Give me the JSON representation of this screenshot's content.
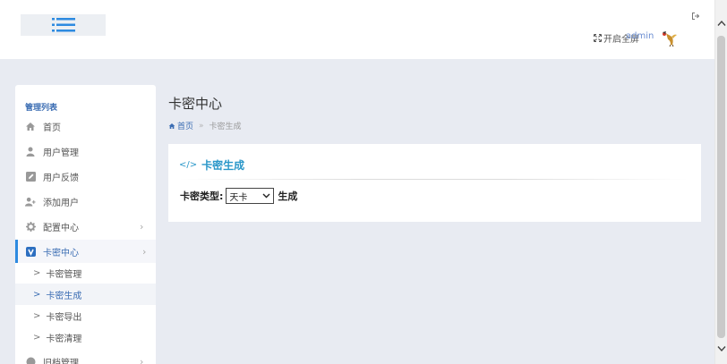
{
  "header": {
    "menu_toggle_icon": "hamburger-icon",
    "fullscreen_label": "开启全屏",
    "username": "admin"
  },
  "sidebar": {
    "title": "管理列表",
    "items": [
      {
        "label": "首页",
        "icon": "home-icon"
      },
      {
        "label": "用户管理",
        "icon": "user-icon"
      },
      {
        "label": "用户反馈",
        "icon": "edit-icon"
      },
      {
        "label": "添加用户",
        "icon": "user-add-icon"
      },
      {
        "label": "配置中心",
        "icon": "gear-icon"
      },
      {
        "label": "卡密中心",
        "icon": "v-card-icon"
      }
    ],
    "sub_items": [
      "卡密管理",
      "卡密生成",
      "卡密导出",
      "卡密清理"
    ],
    "last_item": "旧档管理"
  },
  "main": {
    "page_title": "卡密中心",
    "breadcrumb": {
      "home": "首页",
      "current": "卡密生成"
    },
    "panel": {
      "heading_icon": "</>",
      "heading": "卡密生成",
      "type_label": "卡密类型:",
      "select_value": "天卡",
      "generate_label": "生成"
    }
  },
  "colors": {
    "accent": "#2d8ae0",
    "link": "#3b6db3",
    "panel_heading": "#2a97c9",
    "background": "#e8ebf2"
  }
}
